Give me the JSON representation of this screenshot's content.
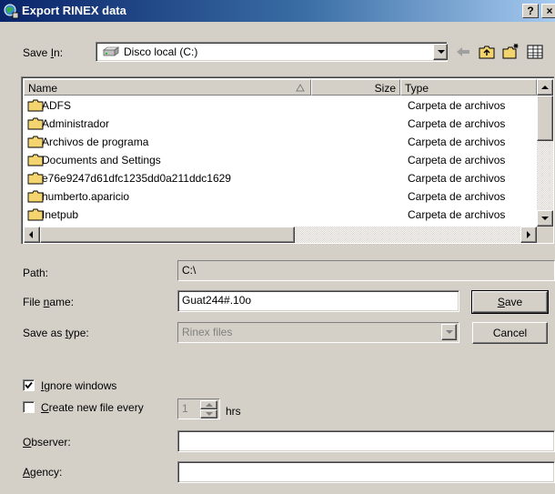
{
  "window": {
    "title": "Export RINEX data",
    "help_label": "?",
    "close_label": "×"
  },
  "save_in": {
    "label_pre": "Save ",
    "label_key": "I",
    "label_post": "n:",
    "value": "Disco local (C:)"
  },
  "file_list": {
    "columns": [
      "Name",
      "Size",
      "Type"
    ],
    "rows": [
      {
        "name": "ADFS",
        "type": "Carpeta de archivos"
      },
      {
        "name": "Administrador",
        "type": "Carpeta de archivos"
      },
      {
        "name": "Archivos de programa",
        "type": "Carpeta de archivos"
      },
      {
        "name": "Documents and Settings",
        "type": "Carpeta de archivos"
      },
      {
        "name": "e76e9247d61dfc1235dd0a211ddc1629",
        "type": "Carpeta de archivos"
      },
      {
        "name": "humberto.aparicio",
        "type": "Carpeta de archivos"
      },
      {
        "name": "Inetpub",
        "type": "Carpeta de archivos"
      }
    ]
  },
  "path": {
    "label": "Path:",
    "value": "C:\\"
  },
  "file_name": {
    "label_pre": "File ",
    "label_key": "n",
    "label_post": "ame:",
    "value": "Guat244#.10o"
  },
  "save_as_type": {
    "label_pre": "Save as ",
    "label_key": "t",
    "label_post": "ype:",
    "value": "Rinex files"
  },
  "buttons": {
    "save_key": "S",
    "save_rest": "ave",
    "cancel": "Cancel"
  },
  "ignore_windows": {
    "checked": true,
    "label_key": "I",
    "label_rest": "gnore windows"
  },
  "create_new_file": {
    "checked": false,
    "label_key": "C",
    "label_rest": "reate new file every",
    "value": "1",
    "unit": "hrs"
  },
  "observer": {
    "label_key": "O",
    "label_rest": "bserver:",
    "value": ""
  },
  "agency": {
    "label_key": "A",
    "label_rest": "gency:",
    "value": ""
  },
  "colors": {
    "face": "#d4d0c8",
    "title_dark": "#0a246a",
    "title_light": "#a6caf0",
    "folder": "#f3d46f"
  }
}
